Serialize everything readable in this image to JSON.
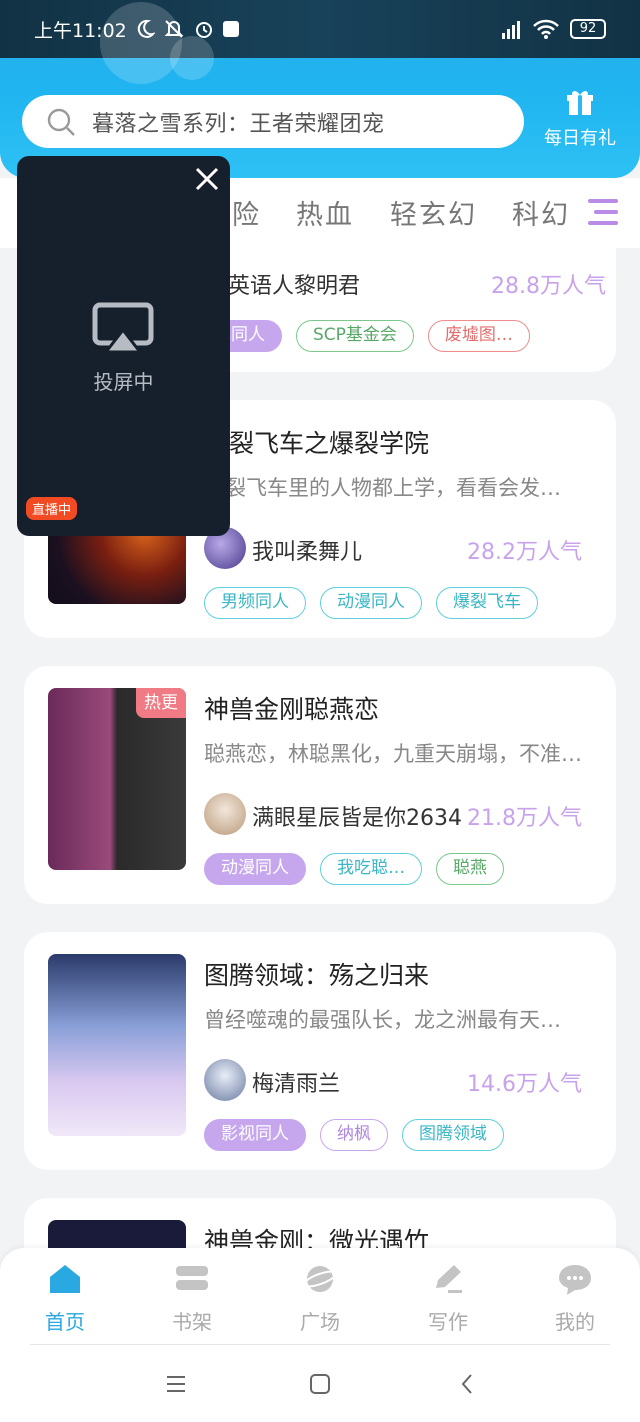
{
  "status": {
    "time": "上午11:02",
    "battery": "92"
  },
  "search": {
    "placeholder": "暮落之雪系列：王者荣耀团宠"
  },
  "gift": {
    "label": "每日有礼"
  },
  "tabs": [
    "险",
    "热血",
    "轻玄幻",
    "科幻"
  ],
  "overlay": {
    "label": "投屏中",
    "live_badge": "直播中"
  },
  "cards": [
    {
      "title": "",
      "desc": "",
      "author": "英语人黎明君",
      "popularity": "28.8万人气",
      "tags": [
        "游戏同人",
        "SCP基金会",
        "废墟图…"
      ]
    },
    {
      "title": "爆裂飞车之爆裂学院",
      "desc": "爆裂飞车里的人物都上学，看看会发…",
      "author": "我叫柔舞儿",
      "popularity": "28.2万人气",
      "tags": [
        "男频同人",
        "动漫同人",
        "爆裂飞车"
      ]
    },
    {
      "title": "神兽金刚聪燕恋",
      "desc": "聪燕恋，林聪黑化，九重天崩塌，不准…",
      "author": "满眼星辰皆是你2634",
      "popularity": "21.8万人气",
      "tags": [
        "动漫同人",
        "我吃聪…",
        "聪燕"
      ],
      "badge": "热更"
    },
    {
      "title": "图腾领域：殇之归来",
      "desc": "曾经噬魂的最强队长，龙之洲最有天…",
      "author": "梅清雨兰",
      "popularity": "14.6万人气",
      "tags": [
        "影视同人",
        "纳枫",
        "图腾领域"
      ]
    },
    {
      "title": "神兽金刚：微光遇竹"
    }
  ],
  "nav": [
    {
      "label": "首页",
      "active": true
    },
    {
      "label": "书架"
    },
    {
      "label": "广场"
    },
    {
      "label": "写作"
    },
    {
      "label": "我的"
    }
  ],
  "colors": {
    "accent": "#2aa8e2",
    "popularity": "#c9a2ec",
    "hot_badge": "#f07b84",
    "live_badge": "#f24b24"
  }
}
